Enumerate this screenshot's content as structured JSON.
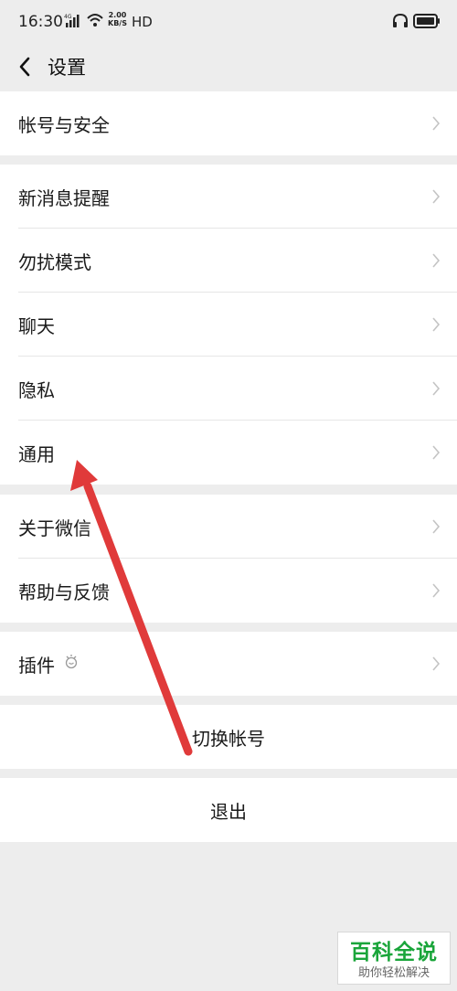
{
  "status_bar": {
    "time": "16:30",
    "net_type": "4G",
    "speed_value": "2.00",
    "speed_unit": "KB/S",
    "hd": "HD"
  },
  "nav": {
    "title": "设置"
  },
  "groups": {
    "account": [
      "帐号与安全"
    ],
    "main": [
      "新消息提醒",
      "勿扰模式",
      "聊天",
      "隐私",
      "通用"
    ],
    "about": [
      "关于微信",
      "帮助与反馈"
    ],
    "plugins": [
      "插件"
    ]
  },
  "actions": {
    "switch_account": "切换帐号",
    "logout": "退出"
  },
  "watermark": {
    "title": "百科全说",
    "subtitle": "助你轻松解决"
  },
  "colors": {
    "background": "#ededed",
    "card": "#ffffff",
    "arrow": "#e03a3a",
    "watermark_green": "#1aa53a"
  }
}
